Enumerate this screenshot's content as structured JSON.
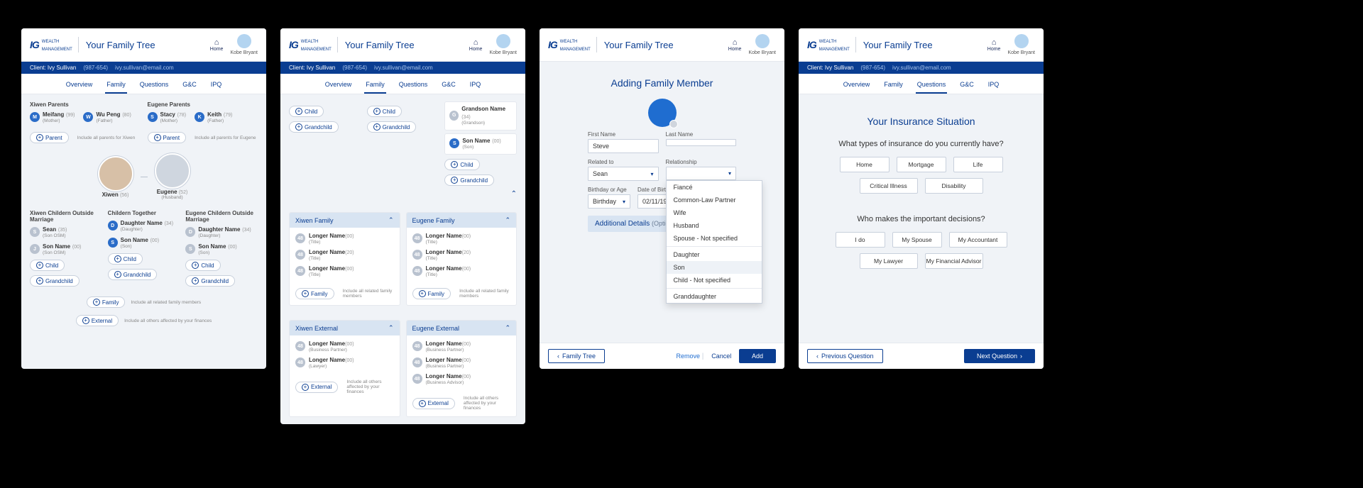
{
  "brand": {
    "ig": "IG",
    "wealth": "WEALTH",
    "mgmt": "MANAGEMENT"
  },
  "page_title": "Your Family Tree",
  "home_label": "Home",
  "user_name": "Kobe Bryant",
  "client_bar": {
    "label": "Client: Ivy Sullivan",
    "id": "(987-654)",
    "email": "ivy.sullivan@email.com"
  },
  "tabs": [
    "Overview",
    "Family",
    "Questions",
    "G&C",
    "IPQ"
  ],
  "screen1": {
    "xiwen_parents_h": "Xiwen Parents",
    "eugene_parents_h": "Eugene Parents",
    "parents_x": [
      {
        "initial": "M",
        "name": "Meifang",
        "age": "(99)",
        "sub": "(Mother)"
      },
      {
        "initial": "W",
        "name": "Wu Peng",
        "age": "(80)",
        "sub": "(Father)"
      }
    ],
    "parents_e": [
      {
        "initial": "S",
        "name": "Stacy",
        "age": "(78)",
        "sub": "(Mother)"
      },
      {
        "initial": "K",
        "name": "Keith",
        "age": "(79)",
        "sub": "(Father)"
      }
    ],
    "parent_pill": "Parent",
    "parent_hint_x": "Include all parents for Xiwen",
    "parent_hint_e": "Include all parents for Eugene",
    "xiwen": {
      "name": "Xiwen",
      "age": "(56)"
    },
    "eugene": {
      "name": "Eugene",
      "age": "(52)",
      "sub": "(Husband)"
    },
    "col_h": [
      "Xiwen Childern Outside Marriage",
      "Childern Together",
      "Eugene Childern Outside Marriage"
    ],
    "kids_left": [
      {
        "initial": "S",
        "name": "Sean",
        "age": "(35)",
        "sub": "(Son OSM)"
      },
      {
        "initial": "J",
        "name": "Son Name",
        "age": "(00)",
        "sub": "(Son OSM)"
      }
    ],
    "kids_mid": [
      {
        "initial": "D",
        "name": "Daughter Name",
        "age": "(34)",
        "sub": "(Daughter)"
      },
      {
        "initial": "S",
        "name": "Son Name",
        "age": "(00)",
        "sub": "(Son)"
      }
    ],
    "kids_right": [
      {
        "initial": "D",
        "name": "Daughter Name",
        "age": "(34)",
        "sub": "(Daughter)"
      },
      {
        "initial": "S",
        "name": "Son Name",
        "age": "(00)",
        "sub": "(Son)"
      }
    ],
    "child_pill": "Child",
    "grandchild_pill": "Grandchild",
    "family_pill": "Family",
    "family_hint": "Include all related family members",
    "external_pill": "External",
    "external_hint": "Include all others affected by your finances"
  },
  "screen2": {
    "chain": [
      {
        "initial": "G",
        "name": "Grandson Name",
        "age": "(34)",
        "sub": "(Grandson)"
      },
      {
        "initial": "S",
        "name": "Son Name",
        "age": "(00)",
        "sub": "(Son)"
      }
    ],
    "xiwen_family_h": "Xiwen Family",
    "eugene_family_h": "Eugene Family",
    "members": [
      {
        "name": "Longer Name",
        "age": "(00)",
        "sub": "(Title)"
      },
      {
        "name": "Longer Name",
        "age": "(20)",
        "sub": "(Title)"
      },
      {
        "name": "Longer Name",
        "age": "(00)",
        "sub": "(Title)"
      }
    ],
    "family_pill": "Family",
    "family_hint": "Include all related family members",
    "xiwen_ext_h": "Xiwen External",
    "eugene_ext_h": "Eugene External",
    "ext_members_x": [
      {
        "name": "Longer Name",
        "age": "(00)",
        "sub": "(Business Partner)"
      },
      {
        "name": "Longer Name",
        "age": "(00)",
        "sub": "(Lawyer)"
      }
    ],
    "ext_members_e": [
      {
        "name": "Longer Name",
        "age": "(00)",
        "sub": "(Business Partner)"
      },
      {
        "name": "Longer Name",
        "age": "(00)",
        "sub": "(Business Partner)"
      },
      {
        "name": "Longer Name",
        "age": "(00)",
        "sub": "(Business Advisor)"
      }
    ],
    "external_pill": "External",
    "external_hint": "Include all others affected by your finances"
  },
  "screen3": {
    "title": "Adding Family Member",
    "first_name_l": "First Name",
    "first_name_v": "Steve",
    "last_name_l": "Last Name",
    "related_l": "Related to",
    "related_v": "Sean",
    "relationship_l": "Relationship",
    "dob_l": "Birthday or Age",
    "dob_sel": "Birthday",
    "dob_l2": "Date of Birth",
    "dob_v": "02/11/1970",
    "details_h": "Additional Details",
    "details_opt": "(Optional)",
    "dd": [
      "Fiancé",
      "Common-Law Partner",
      "Wife",
      "Husband",
      "Spouse - Not specified",
      "Daughter",
      "Son",
      "Child - Not specified",
      "Granddaughter"
    ],
    "footer": {
      "back": "Family Tree",
      "remove": "Remove",
      "cancel": "Cancel",
      "add": "Add"
    }
  },
  "screen4": {
    "title": "Your Insurance Situation",
    "q1": "What types of insurance do you currently have?",
    "q1_opts": [
      "Home",
      "Mortgage",
      "Life",
      "Critical Illness",
      "Disability"
    ],
    "q2": "Who makes the important decisions?",
    "q2_opts": [
      "I do",
      "My Spouse",
      "My Accountant",
      "My Lawyer",
      "My Financial Advisor"
    ],
    "prev": "Previous Question",
    "next": "Next Question"
  }
}
